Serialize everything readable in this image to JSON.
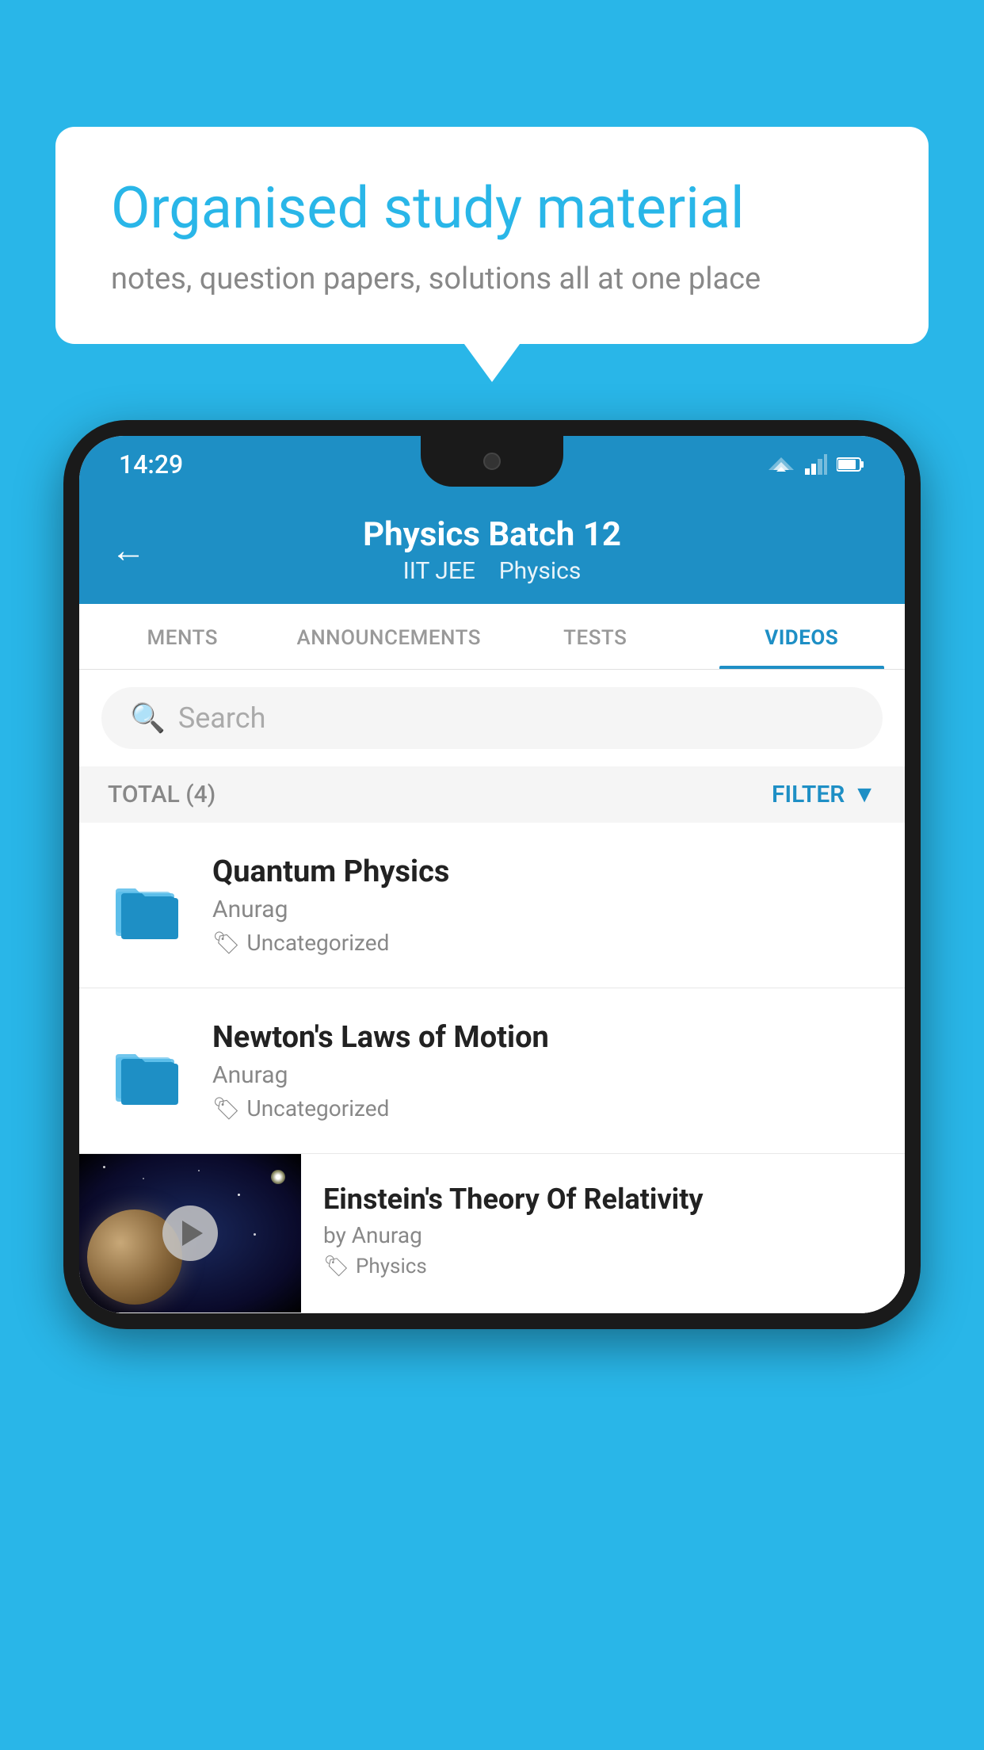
{
  "background_color": "#29b6e8",
  "speech_bubble": {
    "title": "Organised study material",
    "subtitle": "notes, question papers, solutions all at one place"
  },
  "status_bar": {
    "time": "14:29"
  },
  "app_header": {
    "back_label": "←",
    "title": "Physics Batch 12",
    "subtitle_parts": [
      "IIT JEE",
      "Physics"
    ]
  },
  "tabs": [
    {
      "label": "MENTS",
      "active": false
    },
    {
      "label": "ANNOUNCEMENTS",
      "active": false
    },
    {
      "label": "TESTS",
      "active": false
    },
    {
      "label": "VIDEOS",
      "active": true
    }
  ],
  "search": {
    "placeholder": "Search"
  },
  "filter_bar": {
    "total_label": "TOTAL (4)",
    "filter_label": "FILTER"
  },
  "items": [
    {
      "id": "quantum-physics",
      "title": "Quantum Physics",
      "author": "Anurag",
      "tag": "Uncategorized",
      "type": "folder",
      "has_thumbnail": false
    },
    {
      "id": "newtons-laws",
      "title": "Newton's Laws of Motion",
      "author": "Anurag",
      "tag": "Uncategorized",
      "type": "folder",
      "has_thumbnail": false
    },
    {
      "id": "einstein-relativity",
      "title": "Einstein's Theory Of Relativity",
      "author": "by Anurag",
      "tag": "Physics",
      "type": "video",
      "has_thumbnail": true
    }
  ]
}
